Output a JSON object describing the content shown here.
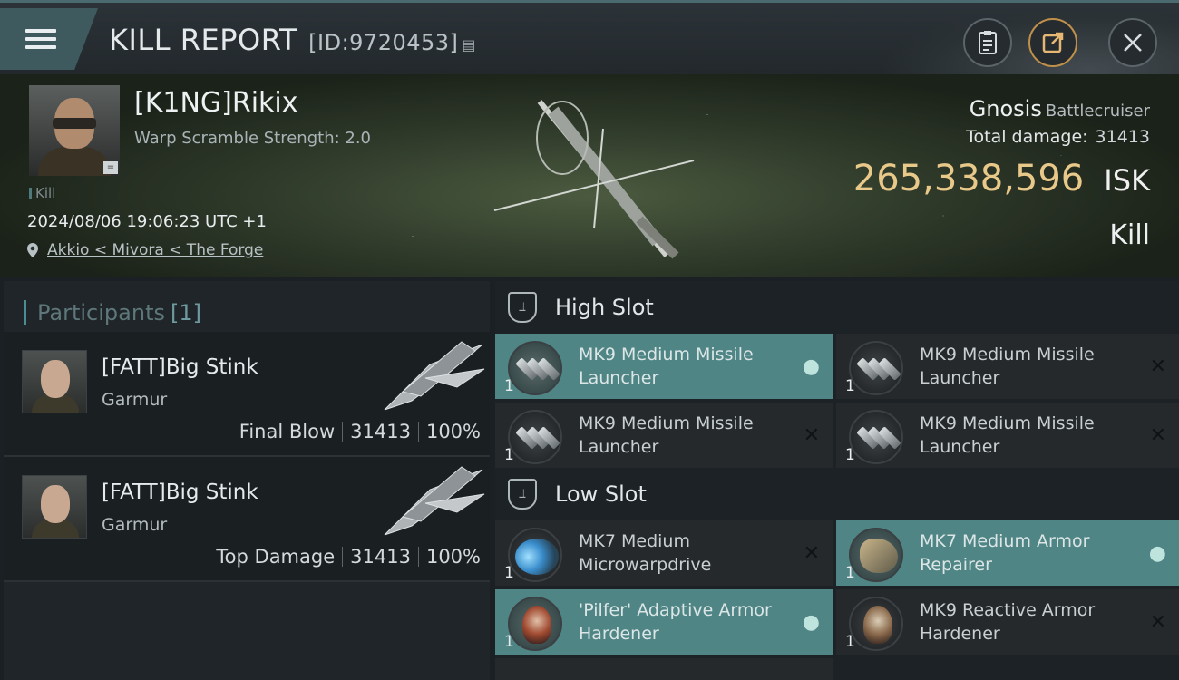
{
  "header": {
    "title": "KILL REPORT",
    "report_id": "[ID:9720453]",
    "menu_icon": "hamburger-icon",
    "buttons": [
      {
        "icon": "clipboard-icon"
      },
      {
        "icon": "share-icon"
      },
      {
        "icon": "close-icon"
      }
    ]
  },
  "victim": {
    "name": "[K1NG]Rikix",
    "warp_scramble": "Warp Scramble Strength: 2.0",
    "tag": "Kill",
    "datetime": "2024/08/06 19:06:23 UTC +1",
    "location": "Akkio < Mivora < The Forge",
    "ship_name": "Gnosis",
    "ship_class": "Battlecruiser",
    "total_damage_label": "Total damage:",
    "total_damage": "31413",
    "isk_value": "265,338,596",
    "isk_unit": "ISK",
    "kill_type": "Kill"
  },
  "participants": {
    "label": "Participants",
    "count": "[1]",
    "rows": [
      {
        "name": "[FATT]Big Stink",
        "ship": "Garmur",
        "role": "Final Blow",
        "damage": "31413",
        "percent": "100%"
      },
      {
        "name": "[FATT]Big Stink",
        "ship": "Garmur",
        "role": "Top Damage",
        "damage": "31413",
        "percent": "100%"
      }
    ]
  },
  "slots": {
    "high": {
      "label": "High Slot",
      "modules": [
        {
          "name": "MK9 Medium Missile Launcher",
          "qty": "1",
          "state": "pilot",
          "active": true
        },
        {
          "name": "MK9 Medium Missile Launcher",
          "qty": "1",
          "state": "destroyed",
          "active": false
        },
        {
          "name": "MK9 Medium Missile Launcher",
          "qty": "1",
          "state": "destroyed",
          "active": false
        },
        {
          "name": "MK9 Medium Missile Launcher",
          "qty": "1",
          "state": "destroyed",
          "active": false
        }
      ]
    },
    "low": {
      "label": "Low Slot",
      "modules": [
        {
          "name": "MK7 Medium Microwarpdrive",
          "qty": "1",
          "state": "destroyed",
          "active": false
        },
        {
          "name": "MK7 Medium Armor Repairer",
          "qty": "1",
          "state": "pilot",
          "active": true
        },
        {
          "name": "'Pilfer' Adaptive Armor Hardener",
          "qty": "1",
          "state": "pilot",
          "active": true
        },
        {
          "name": "MK9 Reactive Armor Hardener",
          "qty": "1",
          "state": "destroyed",
          "active": false
        }
      ]
    }
  },
  "colors": {
    "accent": "#4f8585",
    "isk": "#e9c98a"
  }
}
